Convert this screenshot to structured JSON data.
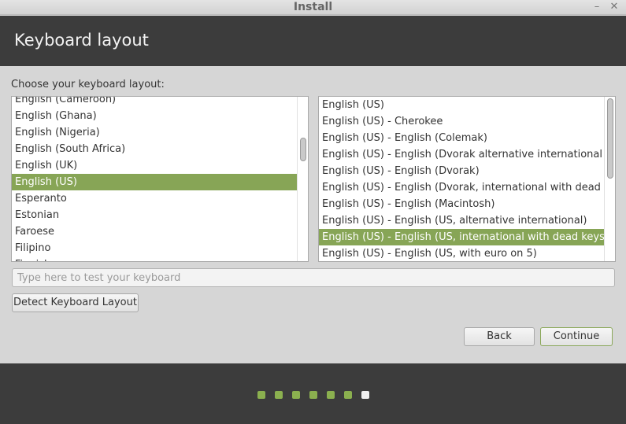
{
  "window": {
    "title": "Install",
    "minimize_glyph": "–",
    "close_glyph": "✕"
  },
  "header": {
    "title": "Keyboard layout"
  },
  "prompt": "Choose your keyboard layout:",
  "layouts": [
    {
      "label": "English (Cameroon)",
      "selected": false
    },
    {
      "label": "English (Ghana)",
      "selected": false
    },
    {
      "label": "English (Nigeria)",
      "selected": false
    },
    {
      "label": "English (South Africa)",
      "selected": false
    },
    {
      "label": "English (UK)",
      "selected": false
    },
    {
      "label": "English (US)",
      "selected": true
    },
    {
      "label": "Esperanto",
      "selected": false
    },
    {
      "label": "Estonian",
      "selected": false
    },
    {
      "label": "Faroese",
      "selected": false
    },
    {
      "label": "Filipino",
      "selected": false
    },
    {
      "label": "Finnish",
      "selected": false
    }
  ],
  "variants": [
    {
      "label": "English (US)",
      "selected": false
    },
    {
      "label": "English (US) - Cherokee",
      "selected": false
    },
    {
      "label": "English (US) - English (Colemak)",
      "selected": false
    },
    {
      "label": "English (US) - English (Dvorak alternative international no dead keys)",
      "selected": false
    },
    {
      "label": "English (US) - English (Dvorak)",
      "selected": false
    },
    {
      "label": "English (US) - English (Dvorak, international with dead keys)",
      "selected": false
    },
    {
      "label": "English (US) - English (Macintosh)",
      "selected": false
    },
    {
      "label": "English (US) - English (US, alternative international)",
      "selected": false
    },
    {
      "label": "English (US) - English (US, international with dead keys)",
      "selected": true
    },
    {
      "label": "English (US) - English (US, with euro on 5)",
      "selected": false
    }
  ],
  "test_input": {
    "placeholder": "Type here to test your keyboard",
    "value": ""
  },
  "buttons": {
    "detect": "Detect Keyboard Layout",
    "back": "Back",
    "continue": "Continue"
  },
  "progress": {
    "total_steps": 7,
    "current_step": 7
  },
  "colors": {
    "accent": "#87a556",
    "dot_done": "#8bb04f",
    "dot_current": "#efefef",
    "header_bg": "#3c3c3c"
  }
}
